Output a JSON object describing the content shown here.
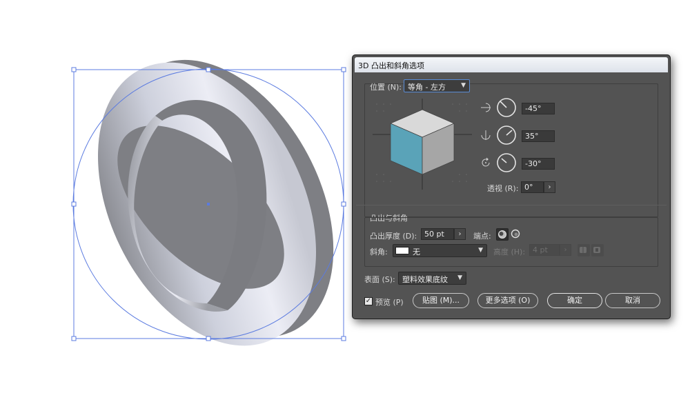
{
  "dialog": {
    "title": "3D 凸出和斜角选项",
    "position": {
      "label": "位置 (N):",
      "preset": "等角 - 左方",
      "x_rotation": "-45°",
      "y_rotation": "35°",
      "z_rotation": "-30°",
      "perspective_label": "透视 (R):",
      "perspective_value": "0°"
    },
    "extrude": {
      "section_title": "凸出与斜角",
      "depth_label": "凸出厚度 (D):",
      "depth_value": "50 pt",
      "cap_label": "端点:",
      "bevel_label": "斜角:",
      "bevel_value": "无",
      "height_label": "高度 (H):",
      "height_value": "4 pt"
    },
    "surface": {
      "label": "表面 (S):",
      "value": "塑料效果底纹"
    },
    "footer": {
      "preview_label": "预览 (P)",
      "preview_checked": true,
      "map_button": "贴图 (M)...",
      "more_button": "更多选项 (O)",
      "ok_button": "确定",
      "cancel_button": "取消"
    }
  },
  "icons": {
    "x_axis": "rotate-x-axis-icon",
    "y_axis": "rotate-y-axis-icon",
    "z_axis": "rotate-z-axis-icon",
    "cap_on": "cap-on-icon",
    "cap_off": "cap-off-icon",
    "bevel_out": "bevel-out-icon",
    "bevel_in": "bevel-in-icon"
  },
  "colors": {
    "selection": "#5b7be0",
    "cube_top": "#d9d9d9",
    "cube_left": "#5aa3b8",
    "cube_right": "#a6a6a6"
  }
}
